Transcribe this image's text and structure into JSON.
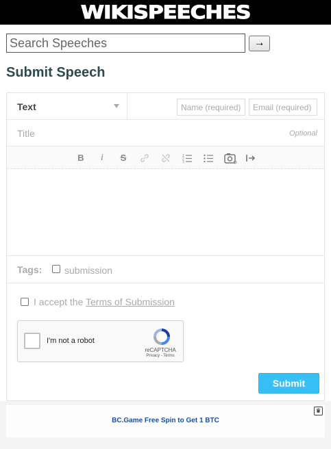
{
  "header": {
    "logo_text": "WIKISPEECHES"
  },
  "search": {
    "placeholder": "Search Speeches",
    "value": "",
    "go_label": "→"
  },
  "page_title": "Submit Speech",
  "form": {
    "type_select": {
      "value": "Text"
    },
    "name_field": {
      "placeholder": "Name (required)"
    },
    "email_field": {
      "placeholder": "Email (required)"
    },
    "title_field": {
      "placeholder": "Title",
      "hint": "Optional"
    },
    "toolbar": {
      "bold": "B",
      "italic": "i",
      "strike": "S",
      "link": "link-icon",
      "unlink": "unlink-icon",
      "ordered_list": "ordered-list-icon",
      "bullet_list": "bullet-list-icon",
      "image": "image-icon",
      "insert": "insert-icon"
    },
    "tags": {
      "label": "Tags:",
      "options": [
        {
          "label": "submission",
          "checked": false
        }
      ]
    },
    "accept": {
      "prefix": "I accept the ",
      "link_text": "Terms of Submission",
      "checked": false
    },
    "captcha": {
      "label": "I'm not a robot",
      "brand": "reCAPTCHA",
      "links": "Privacy - Terms"
    },
    "submit_label": "Submit"
  },
  "ad": {
    "text": "BC.Game Free Spin to Get 1 BTC",
    "badge": "ad-choice-icon"
  },
  "colors": {
    "accent": "#36c0f5",
    "title": "#2e4a4d",
    "header_bg": "#000000",
    "ad_link": "#1a4fa0"
  }
}
